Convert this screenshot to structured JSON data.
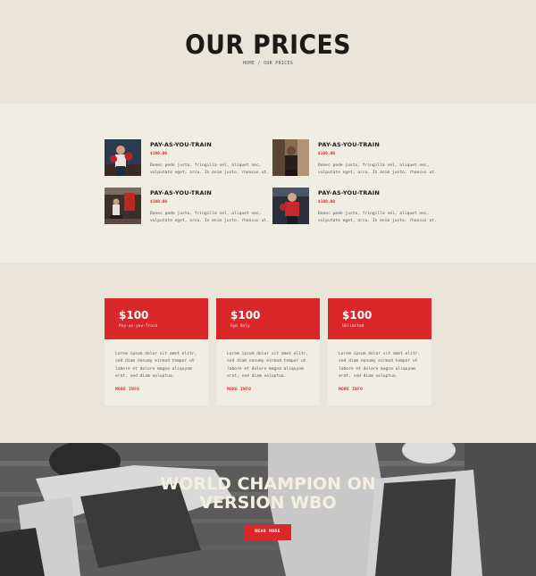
{
  "header": {
    "title": "OUR PRICES",
    "breadcrumb": "HOME / OUR PRICES"
  },
  "plans": [
    {
      "title": "PAY-AS-YOU-TRAIN",
      "price": "$100.00",
      "description": "Donec pede justo, fringilla vel, aliquet nec, vulputate eget, arcu. In enim justo, rhoncus ut."
    },
    {
      "title": "PAY-AS-YOU-TRAIN",
      "price": "$100.00",
      "description": "Donec pede justo, fringilla vel, aliquet nec, vulputate eget, arcu. In enim justo, rhoncus ut."
    },
    {
      "title": "PAY-AS-YOU-TRAIN",
      "price": "$100.00",
      "description": "Donec pede justo, fringilla vel, aliquet nec, vulputate eget, arcu. In enim justo, rhoncus ut."
    },
    {
      "title": "PAY-AS-YOU-TRAIN",
      "price": "$100.00",
      "description": "Donec pede justo, fringilla vel, aliquet nec, vulputate eget, arcu. In enim justo, rhoncus ut."
    }
  ],
  "cards": [
    {
      "amount": "$100",
      "name": "Pay-as-you-Train",
      "description": "Lorem ipsum dolor sit amet elitr, sed diam nonumy eirmod tempor ut labore et dolore magna aliquyam erat, sed diam voluptua.",
      "more": "MORE INFO"
    },
    {
      "amount": "$100",
      "name": "Gym Only",
      "description": "Lorem ipsum dolor sit amet elitr, sed diam nonumy eirmod tempor ut labore et dolore magna aliquyam erat, sed diam voluptua.",
      "more": "MORE INFO"
    },
    {
      "amount": "$100",
      "name": "Unlimited",
      "description": "Lorem ipsum dolor sit amet elitr, sed diam nonumy eirmod tempor ut labore et dolore magna aliquyam erat, sed diam voluptua.",
      "more": "MORE INFO"
    }
  ],
  "banner": {
    "headline_line1": "WORLD CHAMPION ON",
    "headline_line2": "VERSION WBO",
    "cta": "READ MORE"
  },
  "colors": {
    "accent": "#d9272a",
    "background": "#e9e5d9",
    "panel": "#f0ede3"
  }
}
